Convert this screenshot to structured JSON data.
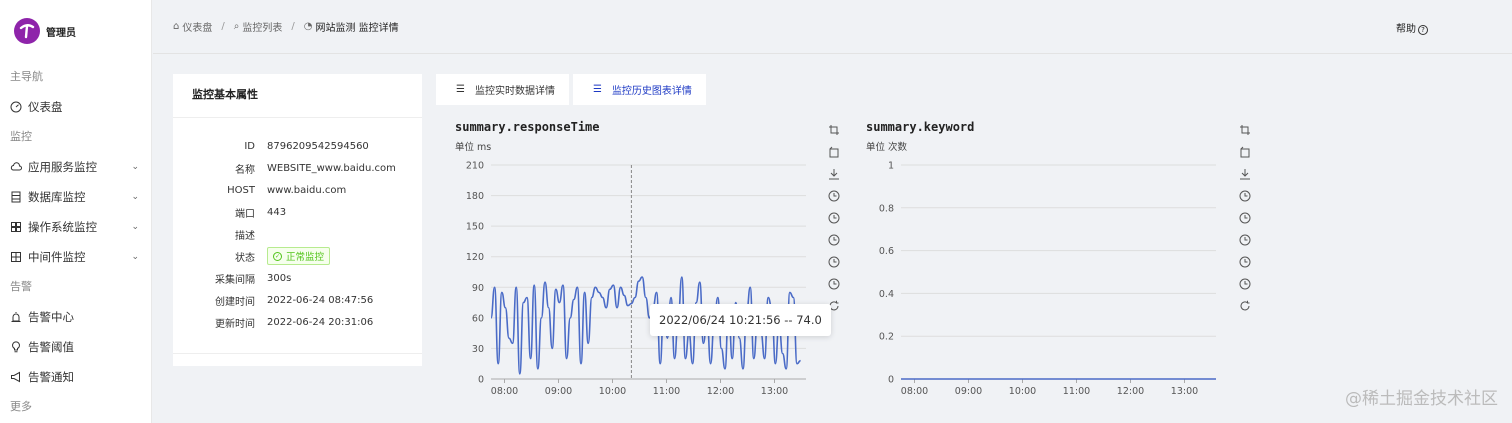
{
  "sidebar": {
    "brand": "管理员",
    "groups": [
      {
        "label": "主导航",
        "items": [
          {
            "label": "仪表盘",
            "icon": "dashboard-icon",
            "expandable": false
          }
        ]
      },
      {
        "label": "监控",
        "items": [
          {
            "label": "应用服务监控",
            "icon": "cloud-icon",
            "expandable": true
          },
          {
            "label": "数据库监控",
            "icon": "database-icon",
            "expandable": true
          },
          {
            "label": "操作系统监控",
            "icon": "windows-icon",
            "expandable": true
          },
          {
            "label": "中间件监控",
            "icon": "grid-icon",
            "expandable": true
          }
        ]
      },
      {
        "label": "告警",
        "items": [
          {
            "label": "告警中心",
            "icon": "alarm-icon",
            "expandable": false
          },
          {
            "label": "告警阈值",
            "icon": "bulb-icon",
            "expandable": false
          },
          {
            "label": "告警通知",
            "icon": "notification-icon",
            "expandable": false
          }
        ]
      },
      {
        "label": "更多",
        "items": []
      }
    ]
  },
  "header": {
    "breadcrumb": [
      {
        "label": "仪表盘",
        "icon": "home-icon"
      },
      {
        "label": "监控列表",
        "icon": "search-icon"
      },
      {
        "label": "网站监测 监控详情",
        "icon": "pie-chart-icon"
      }
    ],
    "help": "帮助"
  },
  "info": {
    "title": "监控基本属性",
    "rows": [
      {
        "key": "ID",
        "value": "8796209542594560"
      },
      {
        "key": "名称",
        "value": "WEBSITE_www.baidu.com"
      },
      {
        "key": "HOST",
        "value": "www.baidu.com"
      },
      {
        "key": "端口",
        "value": "443"
      },
      {
        "key": "描述",
        "value": ""
      },
      {
        "key": "状态",
        "value": "正常监控",
        "tag": true
      },
      {
        "key": "采集间隔",
        "value": "300s"
      },
      {
        "key": "创建时间",
        "value": "2022-06-24 08:47:56"
      },
      {
        "key": "更新时间",
        "value": "2022-06-24 20:31:06"
      }
    ]
  },
  "tabs": [
    {
      "label": "监控实时数据详情",
      "active": false
    },
    {
      "label": "监控历史图表详情",
      "active": true
    }
  ],
  "tooltip": "2022/06/24 10:21:56 -- 74.0",
  "watermark": "@稀土掘金技术社区",
  "colors": {
    "line": "#4a6bc7",
    "accent": "#1d39c4",
    "status": "#52c41a"
  },
  "chart_data": [
    {
      "type": "line",
      "title": "summary.responseTime",
      "unit_label": "单位  ms",
      "ylim": [
        0,
        210
      ],
      "yticks": [
        0,
        30,
        60,
        90,
        120,
        150,
        180,
        210
      ],
      "xlim": [
        "07:45",
        "13:35"
      ],
      "xticks": [
        "08:00",
        "09:00",
        "10:00",
        "11:00",
        "12:00",
        "13:00"
      ],
      "x": [
        "07:45",
        "07:49",
        "07:53",
        "07:57",
        "08:01",
        "08:05",
        "08:09",
        "08:13",
        "08:17",
        "08:21",
        "08:25",
        "08:29",
        "08:33",
        "08:37",
        "08:41",
        "08:45",
        "08:49",
        "08:53",
        "08:57",
        "09:01",
        "09:05",
        "09:09",
        "09:13",
        "09:17",
        "09:21",
        "09:25",
        "09:29",
        "09:33",
        "09:37",
        "09:41",
        "09:45",
        "09:49",
        "09:53",
        "09:57",
        "10:01",
        "10:05",
        "10:09",
        "10:13",
        "10:17",
        "10:21",
        "10:25",
        "10:29",
        "10:33",
        "10:37",
        "10:41",
        "10:45",
        "10:49",
        "10:53",
        "10:57",
        "11:01",
        "11:05",
        "11:09",
        "11:13",
        "11:17",
        "11:21",
        "11:25",
        "11:29",
        "11:33",
        "11:37",
        "11:41",
        "11:45",
        "11:49",
        "11:53",
        "11:57",
        "12:01",
        "12:05",
        "12:09",
        "12:13",
        "12:17",
        "12:21",
        "12:25",
        "12:29",
        "12:33",
        "12:37",
        "12:41",
        "12:45",
        "12:49",
        "12:53",
        "12:57",
        "13:01",
        "13:05",
        "13:09",
        "13:13",
        "13:17",
        "13:21",
        "13:25",
        "13:29",
        "13:33"
      ],
      "values": [
        60,
        90,
        15,
        85,
        70,
        40,
        35,
        90,
        5,
        75,
        80,
        20,
        92,
        10,
        60,
        95,
        70,
        30,
        88,
        75,
        92,
        20,
        60,
        78,
        90,
        15,
        85,
        35,
        80,
        90,
        85,
        80,
        70,
        88,
        92,
        70,
        90,
        82,
        72,
        74,
        80,
        96,
        100,
        80,
        60,
        70,
        85,
        15,
        72,
        40,
        80,
        20,
        60,
        100,
        20,
        45,
        15,
        75,
        95,
        35,
        60,
        15,
        55,
        80,
        30,
        10,
        70,
        20,
        75,
        40,
        10,
        65,
        90,
        20,
        55,
        45,
        20,
        80,
        70,
        15,
        55,
        25,
        10,
        85,
        80,
        15,
        18
      ],
      "tooltip_index": 39
    },
    {
      "type": "line",
      "title": "summary.keyword",
      "unit_label": "单位  次数",
      "ylim": [
        0,
        1
      ],
      "yticks": [
        "0",
        "0.2",
        "0.4",
        "0.6",
        "0.8",
        "1"
      ],
      "xlim": [
        "07:45",
        "13:35"
      ],
      "xticks": [
        "08:00",
        "09:00",
        "10:00",
        "11:00",
        "12:00",
        "13:00"
      ],
      "values": [
        0,
        0
      ]
    }
  ]
}
